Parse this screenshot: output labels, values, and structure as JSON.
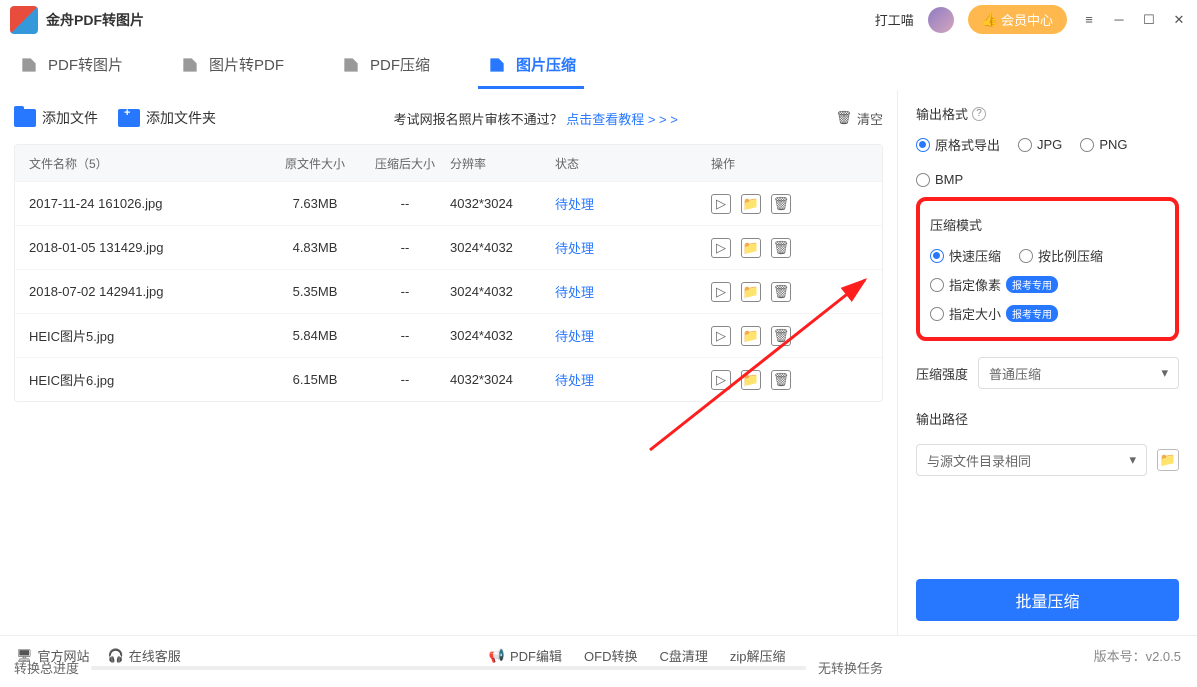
{
  "app": {
    "title": "金舟PDF转图片",
    "username": "打工喵",
    "member_button": "会员中心"
  },
  "tabs": [
    {
      "label": "PDF转图片",
      "active": false
    },
    {
      "label": "图片转PDF",
      "active": false
    },
    {
      "label": "PDF压缩",
      "active": false
    },
    {
      "label": "图片压缩",
      "active": true
    }
  ],
  "toolbar": {
    "add_file": "添加文件",
    "add_folder": "添加文件夹",
    "notice_prefix": "考试网报名照片审核不通过？",
    "notice_link": "点击查看教程 > > >",
    "clear": "清空"
  },
  "table": {
    "headers": {
      "name": "文件名称（5）",
      "orig_size": "原文件大小",
      "comp_size": "压缩后大小",
      "resolution": "分辨率",
      "status": "状态",
      "ops": "操作"
    },
    "rows": [
      {
        "name": "2017-11-24 161026.jpg",
        "orig_size": "7.63MB",
        "comp_size": "--",
        "resolution": "4032*3024",
        "status": "待处理"
      },
      {
        "name": "2018-01-05 131429.jpg",
        "orig_size": "4.83MB",
        "comp_size": "--",
        "resolution": "3024*4032",
        "status": "待处理"
      },
      {
        "name": "2018-07-02 142941.jpg",
        "orig_size": "5.35MB",
        "comp_size": "--",
        "resolution": "3024*4032",
        "status": "待处理"
      },
      {
        "name": "HEIC图片5.jpg",
        "orig_size": "5.84MB",
        "comp_size": "--",
        "resolution": "3024*4032",
        "status": "待处理"
      },
      {
        "name": "HEIC图片6.jpg",
        "orig_size": "6.15MB",
        "comp_size": "--",
        "resolution": "4032*3024",
        "status": "待处理"
      }
    ]
  },
  "progress": {
    "label": "转换总进度",
    "status": "无转换任务"
  },
  "settings": {
    "output_format_label": "输出格式",
    "formats": [
      "原格式导出",
      "JPG",
      "PNG",
      "BMP"
    ],
    "format_selected": "原格式导出",
    "compress_mode_label": "压缩模式",
    "modes": [
      {
        "label": "快速压缩",
        "checked": true,
        "badge": null
      },
      {
        "label": "按比例压缩",
        "checked": false,
        "badge": null
      },
      {
        "label": "指定像素",
        "checked": false,
        "badge": "报考专用"
      },
      {
        "label": "指定大小",
        "checked": false,
        "badge": "报考专用"
      }
    ],
    "strength_label": "压缩强度",
    "strength_value": "普通压缩",
    "output_path_label": "输出路径",
    "output_path_value": "与源文件目录相同",
    "batch_button": "批量压缩"
  },
  "footer": {
    "official_site": "官方网站",
    "online_service": "在线客服",
    "links": [
      "PDF编辑",
      "OFD转换",
      "C盘清理",
      "zip解压缩"
    ],
    "version_label": "版本号：",
    "version": "v2.0.5"
  }
}
